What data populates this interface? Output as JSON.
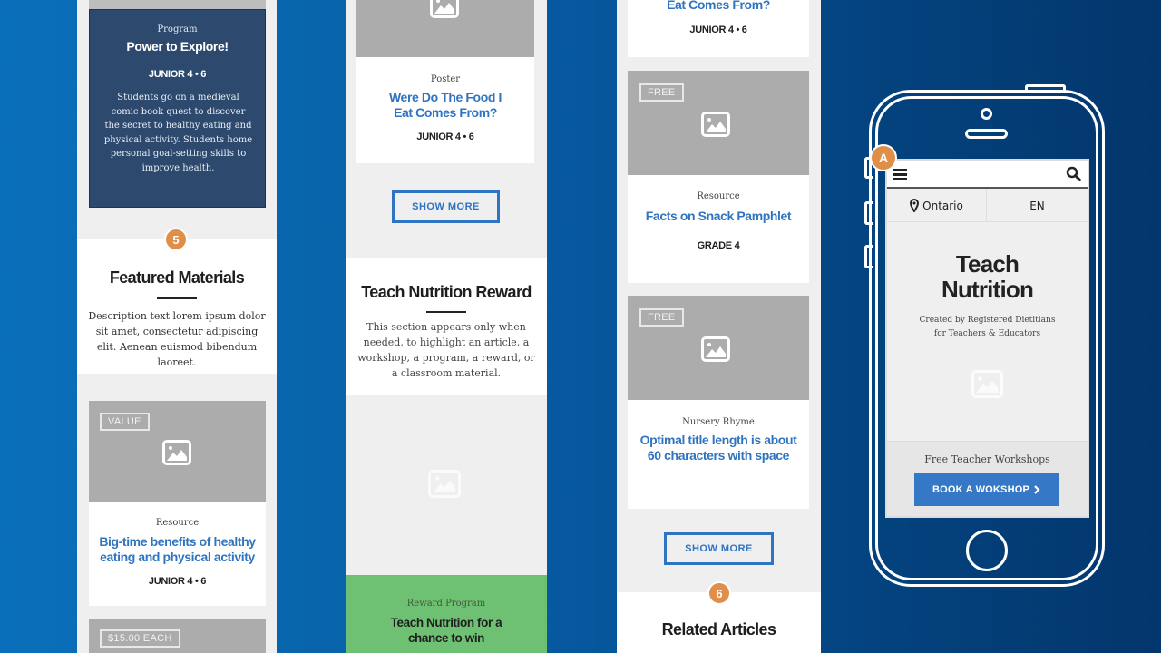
{
  "column1": {
    "program_card": {
      "kicker": "Program",
      "title": "Power to Explore!",
      "grade": "JUNIOR 4 • 6",
      "description": "Students go on a medieval comic book quest to discover the secret to healthy eating and physical activity. Students home personal goal-setting skills to improve health."
    },
    "section_badge": "5",
    "featured": {
      "title": "Featured Materials",
      "description": "Description text lorem ipsum dolor sit amet, consectetur adipiscing elit. Aenean euismod bibendum laoreet."
    },
    "card1": {
      "tag": "VALUE",
      "kicker": "Resource",
      "title": "Big-time benefits of healthy eating and physical activity",
      "grade": "JUNIOR 4 • 6"
    },
    "card2": {
      "tag": "$15.00 EACH"
    }
  },
  "column2": {
    "poster_card": {
      "kicker": "Poster",
      "title": "Were Do The Food  I Eat Comes From?",
      "grade": "JUNIOR 4 • 6"
    },
    "show_more": "SHOW MORE",
    "reward": {
      "title": "Teach Nutrition Reward",
      "description": "This section appears only when needed, to highlight an article, a workshop, a program, a reward, or a classroom material."
    },
    "reward_banner": {
      "kicker": "Reward Program",
      "title": "Teach Nutrition for a chance to win"
    }
  },
  "column3": {
    "top_card": {
      "title_tail": "Eat Comes From?",
      "grade": "JUNIOR 4 • 6"
    },
    "card1": {
      "tag": "FREE",
      "kicker": "Resource",
      "title": "Facts on Snack Pamphlet",
      "grade": "GRADE 4"
    },
    "card2": {
      "tag": "FREE",
      "kicker": "Nursery Rhyme",
      "title": "Optimal title length is about 60 characters with space"
    },
    "show_more": "SHOW MORE",
    "section_badge": "6",
    "related": {
      "title": "Related Articles"
    }
  },
  "phone": {
    "badge": "A",
    "location": "Ontario",
    "language": "EN",
    "hero_title_line1": "Teach",
    "hero_title_line2": "Nutrition",
    "hero_subtitle_line1": "Created by Registered Dietitians",
    "hero_subtitle_line2": "for Teachers & Educators",
    "workshops_label": "Free Teacher Workshops",
    "cta_label": "BOOK A WOKSHOP",
    "cta_icon": "chevron-right-icon"
  },
  "colors": {
    "accent_blue": "#2f74c0",
    "program_navy": "#2d4a6e",
    "badge_orange": "#e08f4a",
    "reward_green": "#6ec072",
    "placeholder_gray": "#acacac"
  }
}
